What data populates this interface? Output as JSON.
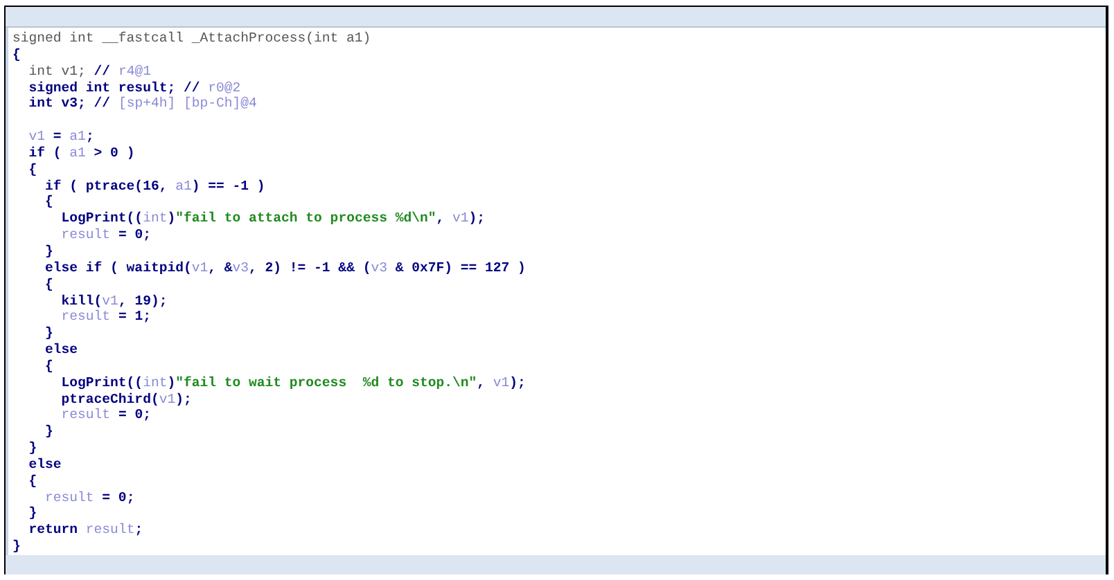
{
  "code_view": {
    "lines": [
      {
        "kind": "code",
        "tokens": [
          {
            "kind": "decl",
            "text": "signed int __fastcall _AttachProcess(int a1)"
          }
        ]
      },
      {
        "kind": "code",
        "tokens": [
          {
            "kind": "code",
            "text": "{"
          }
        ]
      },
      {
        "kind": "code",
        "tokens": [
          {
            "kind": "decl",
            "text": "  int v1; "
          },
          {
            "kind": "code",
            "text": "// "
          },
          {
            "kind": "var",
            "text": "r4@1"
          }
        ]
      },
      {
        "kind": "code",
        "tokens": [
          {
            "kind": "code",
            "text": "  signed int result; // "
          },
          {
            "kind": "var",
            "text": "r0@2"
          }
        ]
      },
      {
        "kind": "code",
        "tokens": [
          {
            "kind": "code",
            "text": "  int v3; // "
          },
          {
            "kind": "var",
            "text": "[sp+4h] [bp-Ch]@4"
          }
        ]
      },
      {
        "kind": "blank"
      },
      {
        "kind": "code",
        "tokens": [
          {
            "kind": "var",
            "text": "  v1"
          },
          {
            "kind": "code",
            "text": " = "
          },
          {
            "kind": "var",
            "text": "a1"
          },
          {
            "kind": "code",
            "text": ";"
          }
        ]
      },
      {
        "kind": "code",
        "tokens": [
          {
            "kind": "code",
            "text": "  if ( "
          },
          {
            "kind": "var",
            "text": "a1"
          },
          {
            "kind": "code",
            "text": " > 0 )"
          }
        ]
      },
      {
        "kind": "code",
        "tokens": [
          {
            "kind": "code",
            "text": "  {"
          }
        ]
      },
      {
        "kind": "code",
        "tokens": [
          {
            "kind": "code",
            "text": "    if ( ptrace(16, "
          },
          {
            "kind": "var",
            "text": "a1"
          },
          {
            "kind": "code",
            "text": ") == -1 )"
          }
        ]
      },
      {
        "kind": "code",
        "tokens": [
          {
            "kind": "code",
            "text": "    {"
          }
        ]
      },
      {
        "kind": "code",
        "tokens": [
          {
            "kind": "code",
            "text": "      LogPrint(("
          },
          {
            "kind": "var",
            "text": "int"
          },
          {
            "kind": "code",
            "text": ")"
          },
          {
            "kind": "string",
            "text": "\"fail to attach to process %d\\n\""
          },
          {
            "kind": "code",
            "text": ", "
          },
          {
            "kind": "var",
            "text": "v1"
          },
          {
            "kind": "code",
            "text": ");"
          }
        ]
      },
      {
        "kind": "code",
        "tokens": [
          {
            "kind": "var",
            "text": "      result"
          },
          {
            "kind": "code",
            "text": " = 0;"
          }
        ]
      },
      {
        "kind": "code",
        "tokens": [
          {
            "kind": "code",
            "text": "    }"
          }
        ]
      },
      {
        "kind": "code",
        "tokens": [
          {
            "kind": "code",
            "text": "    else if ( waitpid("
          },
          {
            "kind": "var",
            "text": "v1"
          },
          {
            "kind": "code",
            "text": ", &"
          },
          {
            "kind": "var",
            "text": "v3"
          },
          {
            "kind": "code",
            "text": ", 2) != -1 && ("
          },
          {
            "kind": "var",
            "text": "v3"
          },
          {
            "kind": "code",
            "text": " & 0x7F) == 127 )"
          }
        ]
      },
      {
        "kind": "code",
        "tokens": [
          {
            "kind": "code",
            "text": "    {"
          }
        ]
      },
      {
        "kind": "code",
        "tokens": [
          {
            "kind": "code",
            "text": "      kill("
          },
          {
            "kind": "var",
            "text": "v1"
          },
          {
            "kind": "code",
            "text": ", 19);"
          }
        ]
      },
      {
        "kind": "code",
        "tokens": [
          {
            "kind": "var",
            "text": "      result"
          },
          {
            "kind": "code",
            "text": " = 1;"
          }
        ]
      },
      {
        "kind": "code",
        "tokens": [
          {
            "kind": "code",
            "text": "    }"
          }
        ]
      },
      {
        "kind": "code",
        "tokens": [
          {
            "kind": "code",
            "text": "    else"
          }
        ]
      },
      {
        "kind": "code",
        "tokens": [
          {
            "kind": "code",
            "text": "    {"
          }
        ]
      },
      {
        "kind": "code",
        "tokens": [
          {
            "kind": "code",
            "text": "      LogPrint(("
          },
          {
            "kind": "var",
            "text": "int"
          },
          {
            "kind": "code",
            "text": ")"
          },
          {
            "kind": "string",
            "text": "\"fail to wait process  %d to stop.\\n\""
          },
          {
            "kind": "code",
            "text": ", "
          },
          {
            "kind": "var",
            "text": "v1"
          },
          {
            "kind": "code",
            "text": ");"
          }
        ]
      },
      {
        "kind": "code",
        "tokens": [
          {
            "kind": "code",
            "text": "      ptraceChird("
          },
          {
            "kind": "var",
            "text": "v1"
          },
          {
            "kind": "code",
            "text": ");"
          }
        ]
      },
      {
        "kind": "code",
        "tokens": [
          {
            "kind": "var",
            "text": "      result"
          },
          {
            "kind": "code",
            "text": " = 0;"
          }
        ]
      },
      {
        "kind": "code",
        "tokens": [
          {
            "kind": "code",
            "text": "    }"
          }
        ]
      },
      {
        "kind": "code",
        "tokens": [
          {
            "kind": "code",
            "text": "  }"
          }
        ]
      },
      {
        "kind": "code",
        "tokens": [
          {
            "kind": "code",
            "text": "  else"
          }
        ]
      },
      {
        "kind": "code",
        "tokens": [
          {
            "kind": "code",
            "text": "  {"
          }
        ]
      },
      {
        "kind": "code",
        "tokens": [
          {
            "kind": "var",
            "text": "    result"
          },
          {
            "kind": "code",
            "text": " = 0;"
          }
        ]
      },
      {
        "kind": "code",
        "tokens": [
          {
            "kind": "code",
            "text": "  }"
          }
        ]
      },
      {
        "kind": "code",
        "tokens": [
          {
            "kind": "code",
            "text": "  return "
          },
          {
            "kind": "var",
            "text": "result"
          },
          {
            "kind": "code",
            "text": ";"
          }
        ]
      },
      {
        "kind": "code",
        "tokens": [
          {
            "kind": "code",
            "text": "}"
          }
        ]
      }
    ]
  }
}
